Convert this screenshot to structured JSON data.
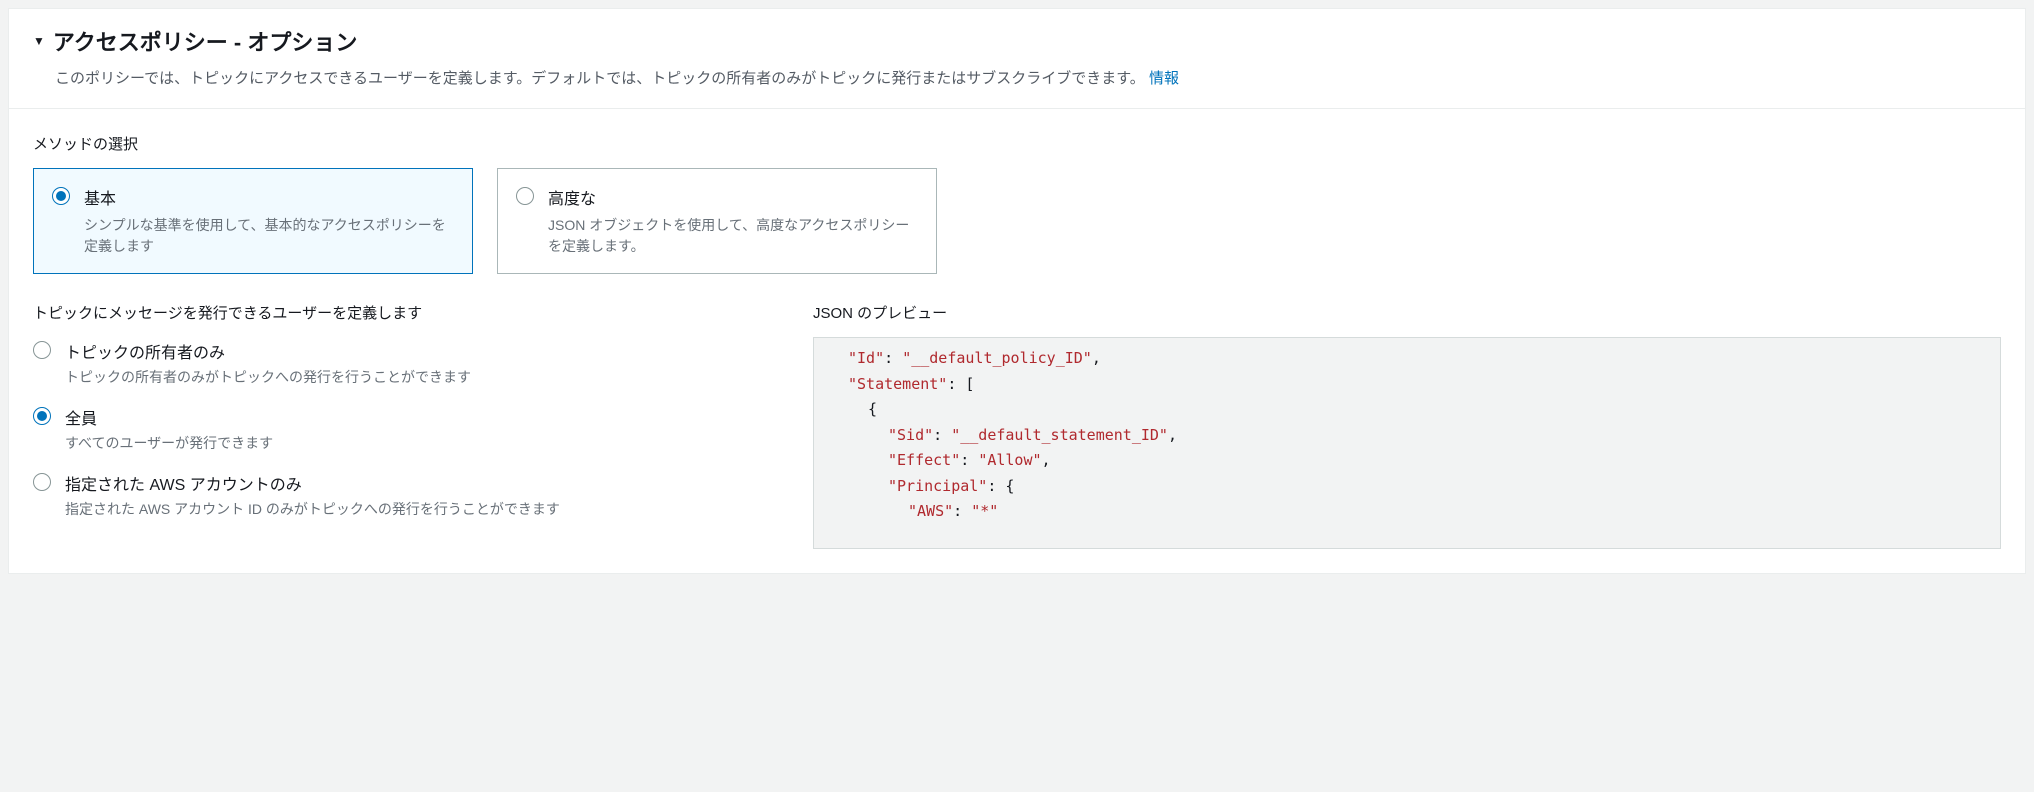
{
  "header": {
    "title": "アクセスポリシー - オプション",
    "description": "このポリシーでは、トピックにアクセスできるユーザーを定義します。デフォルトでは、トピックの所有者のみがトピックに発行またはサブスクライブできます。",
    "info_link": "情報"
  },
  "method": {
    "label": "メソッドの選択",
    "options": [
      {
        "title": "基本",
        "desc": "シンプルな基準を使用して、基本的なアクセスポリシーを定義します",
        "selected": true
      },
      {
        "title": "高度な",
        "desc": "JSON オブジェクトを使用して、高度なアクセスポリシーを定義します。",
        "selected": false
      }
    ]
  },
  "publishers": {
    "label": "トピックにメッセージを発行できるユーザーを定義します",
    "options": [
      {
        "title": "トピックの所有者のみ",
        "desc": "トピックの所有者のみがトピックへの発行を行うことができます",
        "selected": false
      },
      {
        "title": "全員",
        "desc": "すべてのユーザーが発行できます",
        "selected": true
      },
      {
        "title": "指定された AWS アカウントのみ",
        "desc": "指定された AWS アカウント ID のみがトピックへの発行を行うことができます",
        "selected": false
      }
    ]
  },
  "json_preview": {
    "label": "JSON のプレビュー",
    "lines": [
      {
        "indent": 1,
        "key": "\"Id\"",
        "sep": ": ",
        "val": "\"__default_policy_ID\"",
        "comma": ","
      },
      {
        "indent": 1,
        "key": "\"Statement\"",
        "sep": ": ",
        "punc": "["
      },
      {
        "indent": 2,
        "punc": "{"
      },
      {
        "indent": 3,
        "key": "\"Sid\"",
        "sep": ": ",
        "val": "\"__default_statement_ID\"",
        "comma": ","
      },
      {
        "indent": 3,
        "key": "\"Effect\"",
        "sep": ": ",
        "val": "\"Allow\"",
        "comma": ","
      },
      {
        "indent": 3,
        "key": "\"Principal\"",
        "sep": ": ",
        "punc": "{"
      },
      {
        "indent": 4,
        "key": "\"AWS\"",
        "sep": ": ",
        "val": "\"*\""
      }
    ]
  }
}
